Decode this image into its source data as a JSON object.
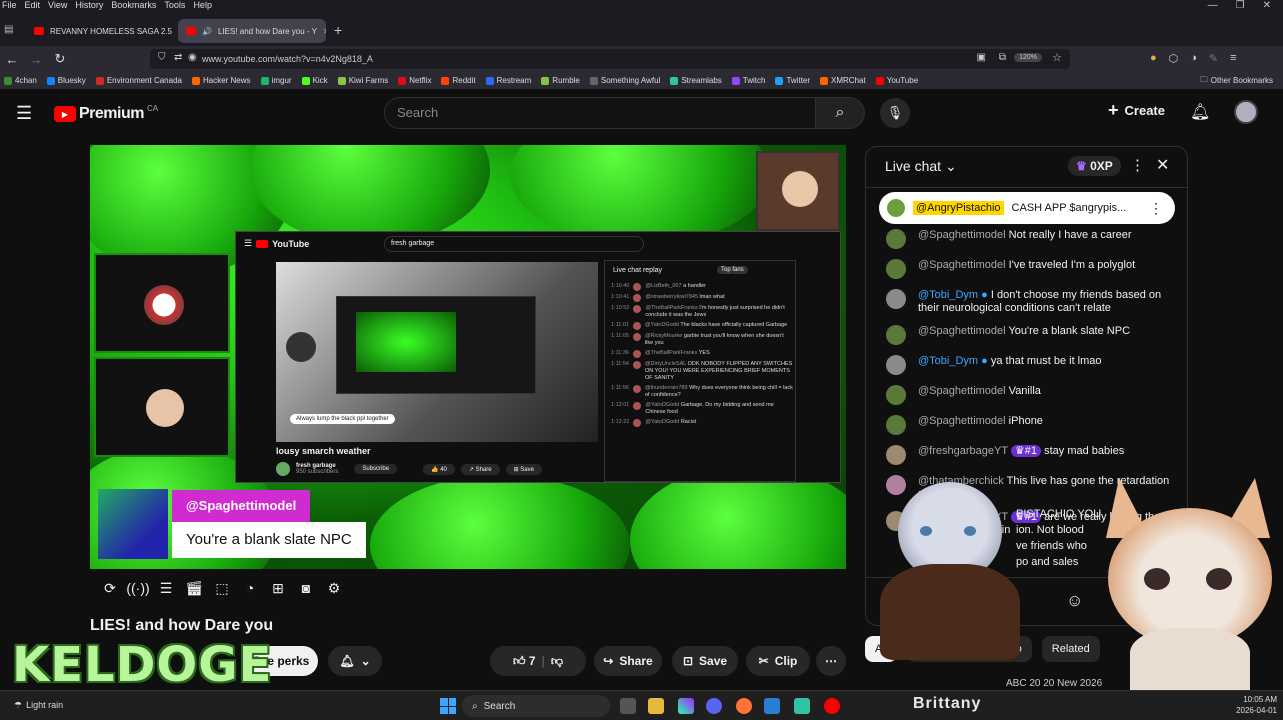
{
  "menu": [
    "File",
    "Edit",
    "View",
    "History",
    "Bookmarks",
    "Tools",
    "Help"
  ],
  "tabs": [
    {
      "label": "REVANNY HOMELESS SAGA 2.5"
    },
    {
      "label": "LIES! and how Dare you - Y"
    }
  ],
  "url": "www.youtube.com/watch?v=n4v2Ng818_A",
  "zoom": "120%",
  "bookmarks": [
    {
      "label": "4chan",
      "color": "#3c8d2f"
    },
    {
      "label": "Bluesky",
      "color": "#1185fe"
    },
    {
      "label": "Environment Canada",
      "color": "#d52b1e"
    },
    {
      "label": "Hacker News",
      "color": "#ff6600"
    },
    {
      "label": "imgur",
      "color": "#1bb76e"
    },
    {
      "label": "Kick",
      "color": "#53fc18"
    },
    {
      "label": "Kiwi Farms",
      "color": "#8bc34a"
    },
    {
      "label": "Netflix",
      "color": "#e50914"
    },
    {
      "label": "Reddit",
      "color": "#ff4500"
    },
    {
      "label": "Restream",
      "color": "#2a6cf6"
    },
    {
      "label": "Rumble",
      "color": "#85c742"
    },
    {
      "label": "Something Awful",
      "color": "#666666"
    },
    {
      "label": "Streamlabs",
      "color": "#31c3a2"
    },
    {
      "label": "Twitch",
      "color": "#9146ff"
    },
    {
      "label": "Twitter",
      "color": "#1da1f2"
    },
    {
      "label": "XMRChat",
      "color": "#ff6600"
    },
    {
      "label": "YouTube",
      "color": "#ff0000"
    }
  ],
  "other_bookmarks": "Other Bookmarks",
  "yt": {
    "brand": "Premium",
    "region": "CA",
    "search_placeholder": "Search",
    "create": "Create"
  },
  "video": {
    "title": "LIES! and how Dare you",
    "overlay_user": "@Spaghettimodel",
    "overlay_message": "You're a blank slate NPC",
    "inner": {
      "search": "fresh garbage",
      "video_title": "lousy smarch weather",
      "channel": "fresh garbage",
      "subs": "950 subscribers",
      "subscribe": "Subscribe",
      "likes": "40",
      "share": "Share",
      "save": "Save",
      "chat_header": "Live chat replay",
      "top_fans": "Top fans",
      "caption": "Always lump the black ppl together",
      "chat": [
        {
          "time": "1:10:40",
          "user": "@LizBeth_007",
          "text": "a handler"
        },
        {
          "time": "1:10:41",
          "user": "@strawberrykiwi7845",
          "text": "lmao what"
        },
        {
          "time": "1:10:52",
          "user": "@TheBallParkFranks",
          "text": "I'm honestly just surprised he didn't conclude it was the Jews"
        },
        {
          "time": "1:11:01",
          "user": "@YatoDGodd",
          "text": "The blacks have officially captured Garbage"
        },
        {
          "time": "1:11:05",
          "user": "@RickyMourke",
          "text": "garbie trust you'll know when she doesn't like you"
        },
        {
          "time": "1:11:36",
          "user": "@TheBallParkFranks",
          "text": "YES"
        },
        {
          "time": "1:11:54",
          "user": "@DirtyUncleSAL",
          "text": "ODK NOBODY FLIPPED ANY SWITCHES ON YOU! YOU WERE EXPERIENCING BRIEF MOMENTS OF SANITY"
        },
        {
          "time": "1:11:56",
          "user": "@thunderrain789",
          "text": "Why does everyone think being chill = lack of confidence?"
        },
        {
          "time": "1:12:01",
          "user": "@YatoDGodd",
          "text": "Garbage. Do my bidding and send me Chinese food"
        },
        {
          "time": "1:12:22",
          "user": "@YatoDGodd",
          "text": "Racist"
        }
      ]
    }
  },
  "controls": [
    "repeat-icon",
    "broadcast-icon",
    "playlist-icon",
    "clapper-icon",
    "crop-icon",
    "speed-icon",
    "add-clip-icon",
    "camera-icon",
    "settings-icon"
  ],
  "actions": {
    "see_perks": "See perks",
    "like_count": "7",
    "share": "Share",
    "save": "Save",
    "clip": "Clip"
  },
  "watermark": "KELDOGE",
  "live_chat": {
    "title": "Live chat",
    "xp": "0XP",
    "pinned_user": "@AngryPistachio",
    "pinned_text": "CASH APP $angrypis...",
    "messages": [
      {
        "user": "@Spaghettimodel",
        "text": "Not really I have a career",
        "avatar": "#5b7a3a"
      },
      {
        "user": "@Spaghettimodel",
        "text": "I've traveled I'm a polyglot",
        "avatar": "#5b7a3a"
      },
      {
        "user": "@Tobi_Dym",
        "text": "I don't choose my friends based on their neurological conditions can't relate",
        "avatar": "#8a8a8a",
        "verified": true
      },
      {
        "user": "@Spaghettimodel",
        "text": "You're a blank slate NPC",
        "avatar": "#5b7a3a"
      },
      {
        "user": "@Tobi_Dym",
        "text": "ya that must be it lmao",
        "avatar": "#8a8a8a",
        "verified": true
      },
      {
        "user": "@Spaghettimodel",
        "text": "Vanilla",
        "avatar": "#5b7a3a"
      },
      {
        "user": "@Spaghettimodel",
        "text": "iPhone",
        "avatar": "#5b7a3a"
      },
      {
        "user": "@freshgarbageYT",
        "text": "stay mad babies",
        "avatar": "#9a8a70",
        "badge": "#1"
      },
      {
        "user": "@thatamberchick",
        "text": "This live has gone the retardation route lol",
        "avatar": "#b080a0"
      },
      {
        "user": "@freshgarbageYT",
        "text": "are we really having the conversation again",
        "avatar": "#9a8a70",
        "badge": "#1"
      }
    ],
    "partial": [
      {
        "text": "PISTACHIO YOU"
      },
      {
        "text": "ion. Not blood"
      },
      {
        "text": "ve friends who"
      },
      {
        "text": "po   and sales"
      }
    ]
  },
  "related_tabs": [
    "All",
    "From Angry Pistachio",
    "Related"
  ],
  "related_next": "ABC 20 20 New 2026",
  "taskbar": {
    "weather": "Light rain",
    "search": "Search",
    "user": "Brittany",
    "time": "10:05 AM",
    "date": "2026-04-01"
  }
}
